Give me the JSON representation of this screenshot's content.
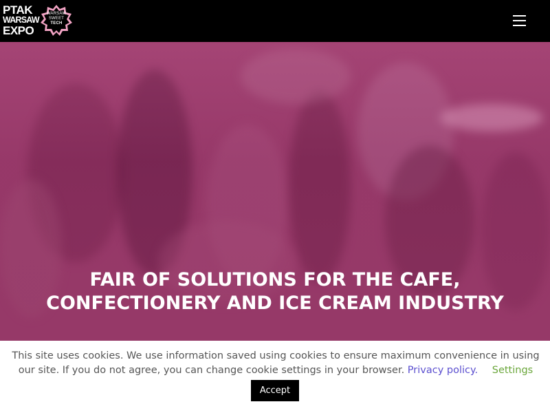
{
  "header": {
    "logo_ptak": [
      "PTAK",
      "WARSAW",
      "EXPO"
    ],
    "logo_badge": [
      "WARSAW",
      "SWEET",
      "TECH"
    ],
    "menu_icon": "hamburger-menu-icon"
  },
  "hero": {
    "title_line1": "FAIR OF SOLUTIONS FOR THE CAFE,",
    "title_line2": "CONFECTIONERY AND ICE CREAM INDUSTRY",
    "overlay_color": "#9c3d6d"
  },
  "cookie_banner": {
    "text": "This site uses cookies. We use information saved using cookies to ensure maximum convenience in using our site. If you do not agree, you can change cookie settings in your browser.",
    "privacy_link": "Privacy policy.",
    "settings_link": "Settings",
    "accept_label": "Accept"
  },
  "colors": {
    "header_bg": "#000000",
    "badge_pink": "#f2a3c4",
    "link_blue": "#5b4fcf",
    "link_green": "#6aa63a"
  }
}
